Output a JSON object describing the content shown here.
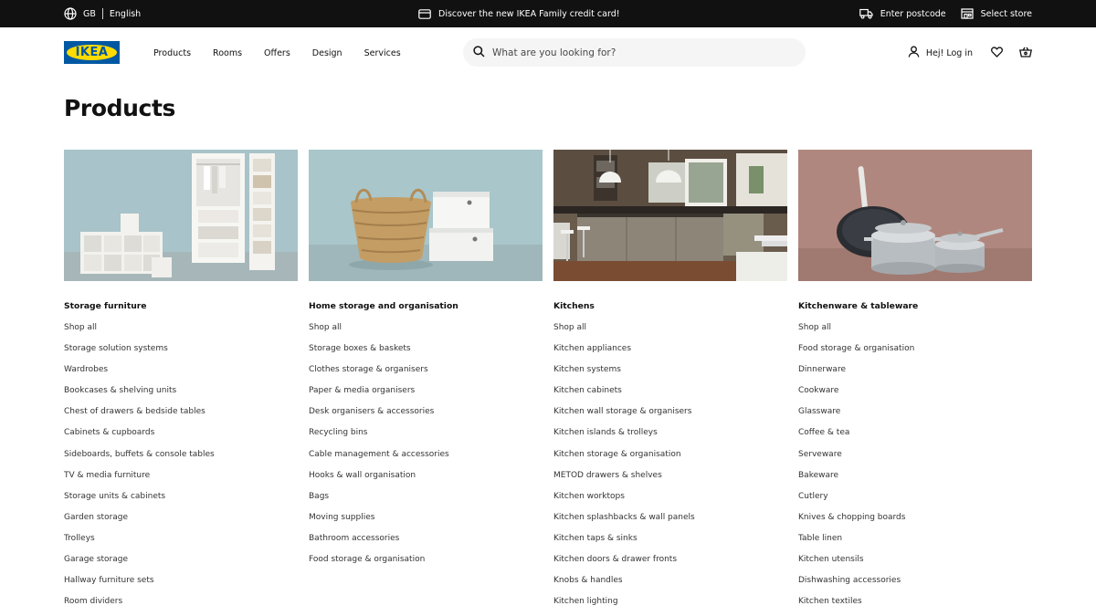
{
  "topbar": {
    "country": "GB",
    "language": "English",
    "promo": "Discover the new IKEA Family credit card!",
    "postcode": "Enter postcode",
    "store": "Select store"
  },
  "header": {
    "logo_text": "IKEA",
    "nav": [
      "Products",
      "Rooms",
      "Offers",
      "Design",
      "Services"
    ],
    "search_placeholder": "What are you looking for?",
    "login": "Hej! Log in"
  },
  "page": {
    "title": "Products"
  },
  "columns": [
    {
      "heading": "Storage furniture",
      "links": [
        "Shop all",
        "Storage solution systems",
        "Wardrobes",
        "Bookcases & shelving units",
        "Chest of drawers & bedside tables",
        "Cabinets & cupboards",
        "Sideboards, buffets & console tables",
        "TV & media furniture",
        "Storage units & cabinets",
        "Garden storage",
        "Trolleys",
        "Garage storage",
        "Hallway furniture sets",
        "Room dividers"
      ]
    },
    {
      "heading": "Home storage and organisation",
      "links": [
        "Shop all",
        "Storage boxes & baskets",
        "Clothes storage & organisers",
        "Paper & media organisers",
        "Desk organisers & accessories",
        "Recycling bins",
        "Cable management & accessories",
        "Hooks & wall organisation",
        "Bags",
        "Moving supplies",
        "Bathroom accessories",
        "Food storage & organisation"
      ]
    },
    {
      "heading": "Kitchens",
      "links": [
        "Shop all",
        "Kitchen appliances",
        "Kitchen systems",
        "Kitchen cabinets",
        "Kitchen wall storage & organisers",
        "Kitchen islands & trolleys",
        "Kitchen storage & organisation",
        "METOD drawers & shelves",
        "Kitchen worktops",
        "Kitchen splashbacks & wall panels",
        "Kitchen taps & sinks",
        "Kitchen doors & drawer fronts",
        "Knobs & handles",
        "Kitchen lighting"
      ]
    },
    {
      "heading": "Kitchenware & tableware",
      "links": [
        "Shop all",
        "Food storage & organisation",
        "Dinnerware",
        "Cookware",
        "Glassware",
        "Coffee & tea",
        "Serveware",
        "Bakeware",
        "Cutlery",
        "Knives & chopping boards",
        "Table linen",
        "Kitchen utensils",
        "Dishwashing accessories",
        "Kitchen textiles"
      ]
    }
  ]
}
